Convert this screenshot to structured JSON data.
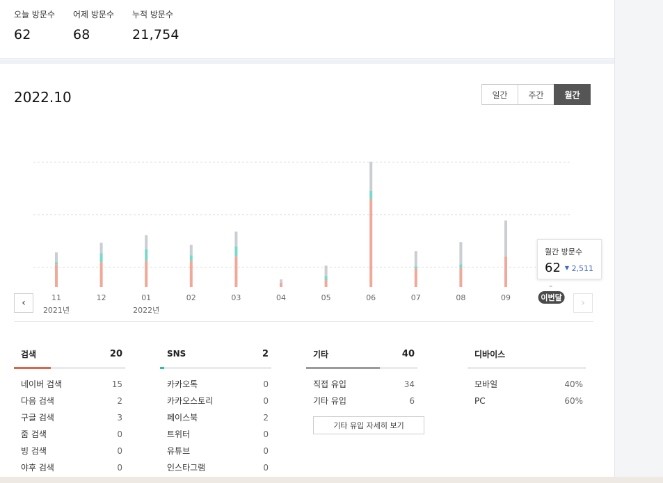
{
  "summary": {
    "today": {
      "label": "오늘 방문수",
      "value": "62"
    },
    "yesterday": {
      "label": "어제 방문수",
      "value": "68"
    },
    "total": {
      "label": "누적 방문수",
      "value": "21,754"
    }
  },
  "period_title": "2022.10",
  "view_toggle": {
    "daily": "일간",
    "weekly": "주간",
    "monthly": "월간",
    "active": "monthly"
  },
  "colors": {
    "search": "#f0a898",
    "sns": "#79d8cc",
    "etc": "#c9ced2",
    "search_accent": "#e0624c",
    "sns_accent": "#2bbfa6",
    "etc_accent": "#9a9a9a"
  },
  "chart_data": {
    "type": "bar",
    "stacked": true,
    "grid": true,
    "categories": [
      "11",
      "12",
      "01",
      "02",
      "03",
      "04",
      "05",
      "06",
      "07",
      "08",
      "09",
      "이번달"
    ],
    "year_labels": [
      {
        "index": 0,
        "text": "2021년"
      },
      {
        "index": 2,
        "text": "2022년"
      }
    ],
    "series": [
      {
        "key": "search",
        "values": [
          33,
          36,
          38,
          38,
          44,
          6,
          10,
          127,
          27,
          28,
          44,
          0
        ]
      },
      {
        "key": "sns",
        "values": [
          3,
          13,
          17,
          8,
          15,
          0,
          6,
          12,
          3,
          5,
          0,
          0
        ]
      },
      {
        "key": "etc",
        "values": [
          14,
          15,
          20,
          15,
          21,
          5,
          15,
          42,
          22,
          32,
          52,
          2
        ]
      }
    ],
    "ylim": [
      0,
      230
    ]
  },
  "tooltip": {
    "label": "월간 방문수",
    "value": "62",
    "delta": "2,511"
  },
  "current_badge": "이번달",
  "nav": {
    "prev_icon": "chevron-left-icon",
    "next_icon": "chevron-right-icon"
  },
  "sections": {
    "search": {
      "title": "검색",
      "total": "20",
      "fill_ratio": 0.33,
      "items": [
        {
          "label": "네이버 검색",
          "value": "15"
        },
        {
          "label": "다음 검색",
          "value": "2"
        },
        {
          "label": "구글 검색",
          "value": "3"
        },
        {
          "label": "줌 검색",
          "value": "0"
        },
        {
          "label": "빙 검색",
          "value": "0"
        },
        {
          "label": "야후 검색",
          "value": "0"
        }
      ]
    },
    "sns": {
      "title": "SNS",
      "total": "2",
      "fill_ratio": 0.04,
      "items": [
        {
          "label": "카카오톡",
          "value": "0"
        },
        {
          "label": "카카오스토리",
          "value": "0"
        },
        {
          "label": "페이스북",
          "value": "2"
        },
        {
          "label": "트위터",
          "value": "0"
        },
        {
          "label": "유튜브",
          "value": "0"
        },
        {
          "label": "인스타그램",
          "value": "0"
        }
      ]
    },
    "etc": {
      "title": "기타",
      "total": "40",
      "fill_ratio": 0.66,
      "items": [
        {
          "label": "직접 유입",
          "value": "34"
        },
        {
          "label": "기타 유입",
          "value": "6"
        }
      ],
      "more_label": "기타 유입 자세히 보기"
    },
    "device": {
      "title": "디바이스",
      "items": [
        {
          "label": "모바일",
          "value": "40%"
        },
        {
          "label": "PC",
          "value": "60%"
        }
      ]
    }
  }
}
